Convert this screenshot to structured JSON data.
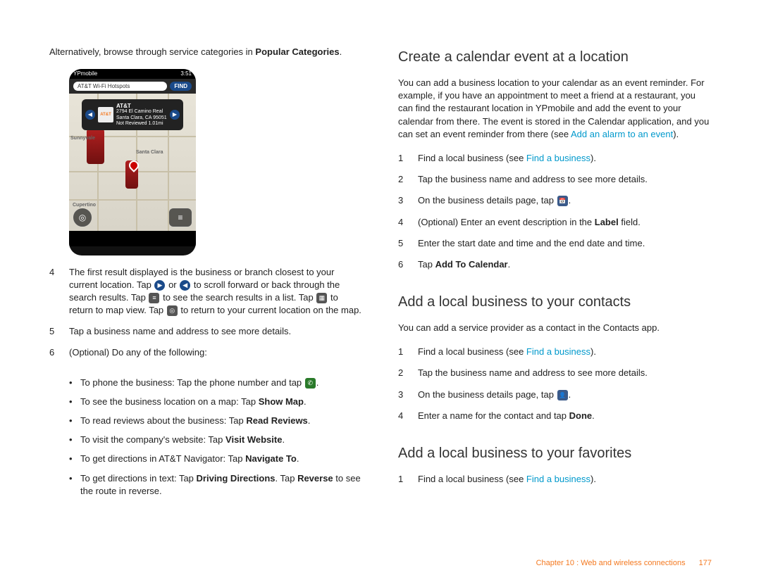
{
  "left": {
    "intro_pre": "Alternatively, browse through service categories in ",
    "intro_bold": "Popular Categories",
    "intro_post": ".",
    "screenshot": {
      "status_app": "YPmobile",
      "status_time": "3:51",
      "search_value": "AT&T Wi-Fi Hotspots",
      "find_label": "FIND",
      "popup_brand": "AT&T",
      "popup_addr1": "2794 El Camino Real",
      "popup_addr2": "Santa Clara, CA 95051",
      "popup_meta": "Not Reviewed    1.01mi",
      "city1": "Sunnyvale",
      "city2": "Santa Clara",
      "city3": "Cupertino"
    },
    "step4": {
      "num": "4",
      "p1": "The first result displayed is the business or branch closest to your current location. Tap ",
      "p2": " or ",
      "p3": " to scroll forward or back through the search results. Tap ",
      "p4": " to see the search results in a list. Tap ",
      "p5": " to return to map view. Tap ",
      "p6": " to return to your current location on the map."
    },
    "step5": {
      "num": "5",
      "text": "Tap a business name and address to see more details."
    },
    "step6": {
      "num": "6",
      "text": "(Optional) Do any of the following:"
    },
    "bullets": {
      "b1_pre": "To phone the business: Tap the phone number and tap ",
      "b1_post": ".",
      "b2_pre": "To see the business location on a map: Tap ",
      "b2_bold": "Show Map",
      "b2_post": ".",
      "b3_pre": "To read reviews about the business: Tap ",
      "b3_bold": "Read Reviews",
      "b3_post": ".",
      "b4_pre": "To visit the company's website: Tap ",
      "b4_bold": "Visit Website",
      "b4_post": ".",
      "b5_pre": "To get directions in AT&T Navigator: Tap ",
      "b5_bold": "Navigate To",
      "b5_post": ".",
      "b6_pre": "To get directions in text: Tap ",
      "b6_bold": "Driving Directions",
      "b6_mid": ". Tap ",
      "b6_bold2": "Reverse",
      "b6_post": " to see the route in reverse."
    }
  },
  "right": {
    "h1": "Create a calendar event at a location",
    "p1_pre": "You can add a business location to your calendar as an event reminder. For example, if you have an appointment to meet a friend at a restaurant, you can find the restaurant location in YPmobile and add the event to your calendar from there. The event is stored in the Calendar application, and you can set an event reminder from there (see ",
    "p1_link": "Add an alarm to an event",
    "p1_post": ").",
    "s1_1": {
      "num": "1",
      "pre": "Find a local business (see ",
      "link": "Find a business",
      "post": ")."
    },
    "s1_2": {
      "num": "2",
      "text": "Tap the business name and address to see more details."
    },
    "s1_3": {
      "num": "3",
      "pre": "On the business details page, tap ",
      "post": "."
    },
    "s1_4": {
      "num": "4",
      "pre": "(Optional) Enter an event description in the ",
      "bold": "Label",
      "post": " field."
    },
    "s1_5": {
      "num": "5",
      "text": "Enter the start date and time and the end date and time."
    },
    "s1_6": {
      "num": "6",
      "pre": "Tap ",
      "bold": "Add To Calendar",
      "post": "."
    },
    "h2": "Add a local business to your contacts",
    "p2": "You can add a service provider as a contact in the Contacts app.",
    "s2_1": {
      "num": "1",
      "pre": "Find a local business (see ",
      "link": "Find a business",
      "post": ")."
    },
    "s2_2": {
      "num": "2",
      "text": "Tap the business name and address to see more details."
    },
    "s2_3": {
      "num": "3",
      "pre": "On the business details page, tap ",
      "post": "."
    },
    "s2_4": {
      "num": "4",
      "pre": "Enter a name for the contact and tap ",
      "bold": "Done",
      "post": "."
    },
    "h3": "Add a local business to your favorites",
    "s3_1": {
      "num": "1",
      "pre": "Find a local business (see ",
      "link": "Find a business",
      "post": ")."
    }
  },
  "footer": {
    "chapter": "Chapter 10 : Web and wireless connections",
    "page": "177"
  }
}
